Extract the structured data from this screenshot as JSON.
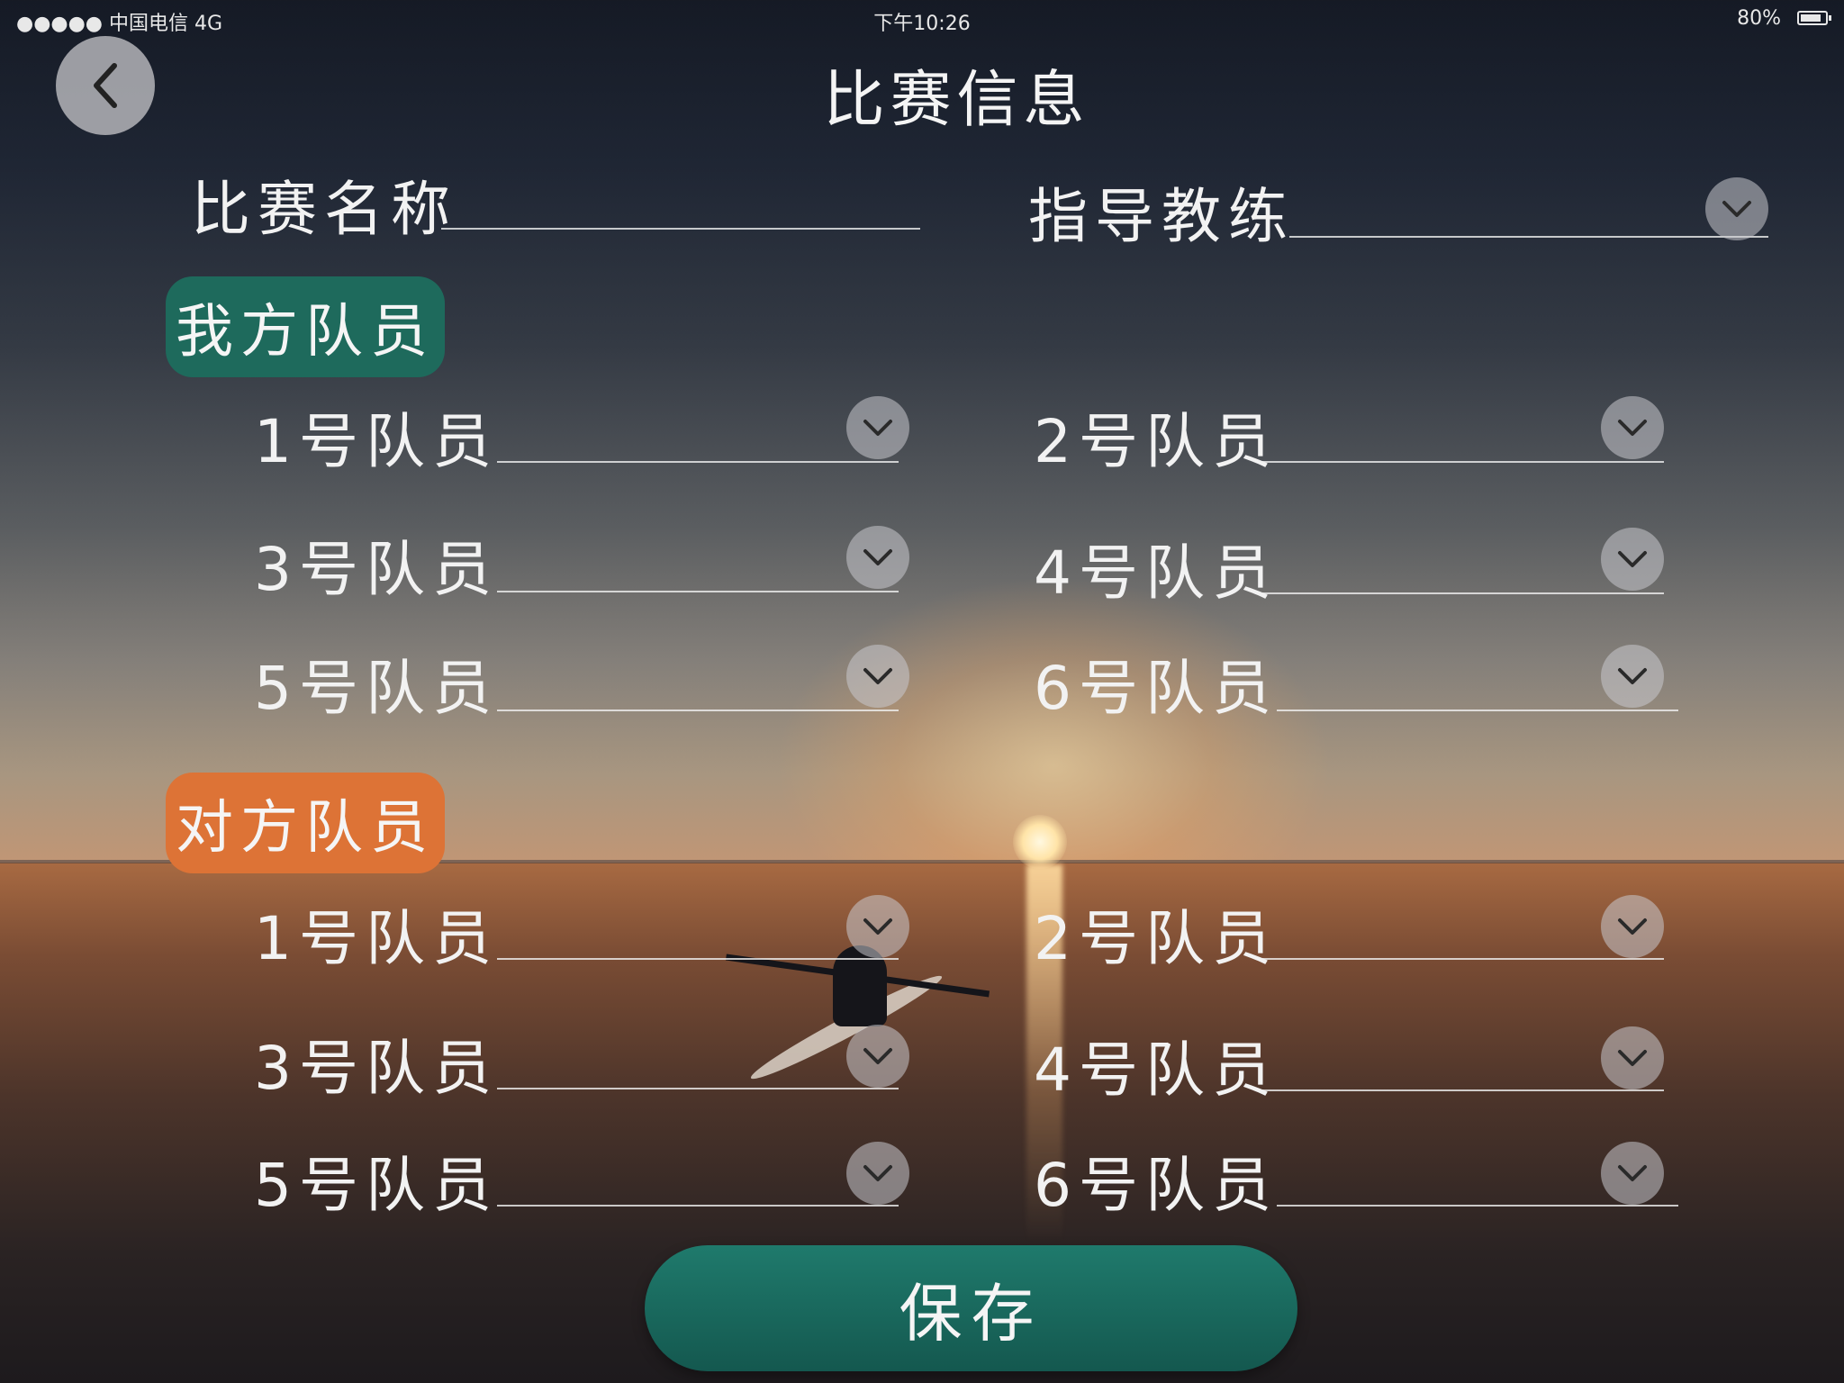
{
  "status_bar": {
    "carrier": "●●●●● 中国电信 4G",
    "time": "下午10:26",
    "battery": "80%"
  },
  "header": {
    "title": "比赛信息"
  },
  "form": {
    "match_name_label": "比赛名称",
    "coach_label": "指导教练"
  },
  "our_team": {
    "heading": "我方队员",
    "players": [
      "1号队员",
      "2号队员",
      "3号队员",
      "4号队员",
      "5号队员",
      "6号队员"
    ]
  },
  "opponent_team": {
    "heading": "对方队员",
    "players": [
      "1号队员",
      "2号队员",
      "3号队员",
      "4号队员",
      "5号队员",
      "6号队员"
    ]
  },
  "actions": {
    "save_label": "保存"
  },
  "icons": {
    "back": "chevron-left-icon",
    "dropdown": "chevron-down-icon"
  },
  "colors": {
    "our_team_accent": "#1e6a5c",
    "opponent_accent": "#dd7336",
    "save_button": "#1f7a6c"
  }
}
